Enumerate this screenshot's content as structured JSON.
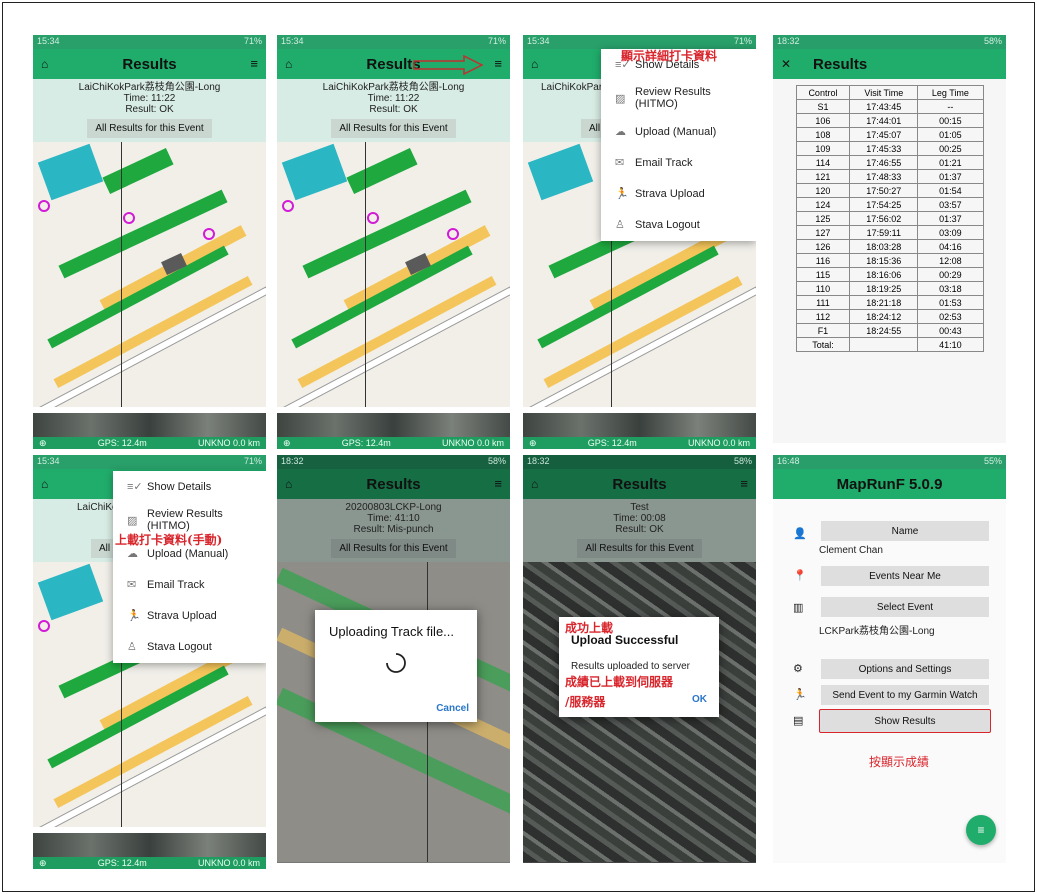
{
  "status": {
    "time1": "15:34",
    "time2": "18:32",
    "time3": "16:48",
    "battery1": "71%",
    "battery2": "58%",
    "battery3": "55%"
  },
  "results_title": "Results",
  "event1": {
    "name": "LaiChiKokPark荔枝角公園-Long",
    "time": "Time: 11:22",
    "result": "Result: OK"
  },
  "all_results_label": "All Results for this Event",
  "gps": {
    "text": "GPS: 12.4m",
    "unk": "UNKNO 0.0 km"
  },
  "annotations": {
    "show_details_cn": "顯示詳細打卡資料",
    "upload_manual_cn": "上載打卡資料(手動)",
    "success_cn": "成功上載",
    "uploaded_cn_1": "成績已上載到伺服器",
    "uploaded_cn_2": "/服務器",
    "press_show_cn": "按顯示成績"
  },
  "menu": {
    "items": [
      "Show Details",
      "Review Results (HITMO)",
      "Upload (Manual)",
      "Email Track",
      "Strava Upload",
      "Stava Logout"
    ]
  },
  "table": {
    "headers": [
      "Control",
      "Visit Time",
      "Leg Time"
    ],
    "rows": [
      [
        "S1",
        "17:43:45",
        "--"
      ],
      [
        "106",
        "17:44:01",
        "00:15"
      ],
      [
        "108",
        "17:45:07",
        "01:05"
      ],
      [
        "109",
        "17:45:33",
        "00:25"
      ],
      [
        "114",
        "17:46:55",
        "01:21"
      ],
      [
        "121",
        "17:48:33",
        "01:37"
      ],
      [
        "120",
        "17:50:27",
        "01:54"
      ],
      [
        "124",
        "17:54:25",
        "03:57"
      ],
      [
        "125",
        "17:56:02",
        "01:37"
      ],
      [
        "127",
        "17:59:11",
        "03:09"
      ],
      [
        "126",
        "18:03:28",
        "04:16"
      ],
      [
        "116",
        "18:15:36",
        "12:08"
      ],
      [
        "115",
        "18:16:06",
        "00:29"
      ],
      [
        "110",
        "18:19:25",
        "03:18"
      ],
      [
        "111",
        "18:21:18",
        "01:53"
      ],
      [
        "112",
        "18:24:12",
        "02:53"
      ],
      [
        "F1",
        "18:24:55",
        "00:43"
      ],
      [
        "Total:",
        "",
        "41:10"
      ]
    ]
  },
  "event2": {
    "name": "20200803LCKP-Long",
    "time": "Time: 41:10",
    "result": "Result: Mis-punch"
  },
  "uploading": {
    "title": "Uploading Track file...",
    "cancel": "Cancel"
  },
  "event3": {
    "name": "Test",
    "time": "Time: 00:08",
    "result": "Result: OK"
  },
  "success": {
    "title": "Upload Successful",
    "msg": "Results uploaded to server",
    "ok": "OK"
  },
  "maprun": {
    "title": "MapRunF 5.0.9",
    "name_btn": "Name",
    "user": "Clement Chan",
    "events_near": "Events Near Me",
    "select_event": "Select Event",
    "event": "LCKPark荔枝角公園-Long",
    "options": "Options and Settings",
    "send_garmin": "Send Event to my Garmin Watch",
    "show_results": "Show Results"
  },
  "colors": {
    "green": "#20ad6b",
    "red": "#d8262d"
  }
}
